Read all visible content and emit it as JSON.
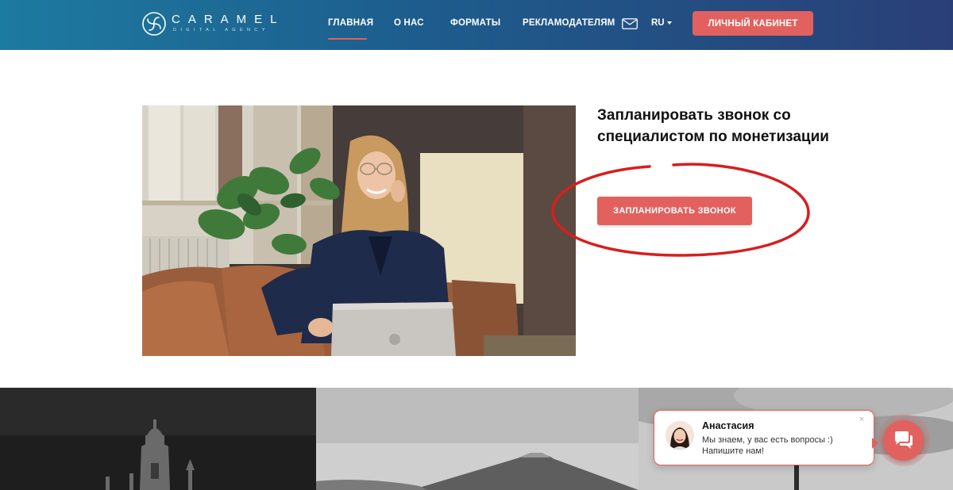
{
  "header": {
    "logo": {
      "name": "CARAMEL",
      "subtitle": "DIGITAL AGENCY",
      "icon": "spiral-logo-icon"
    },
    "nav": [
      {
        "label": "ГЛАВНАЯ",
        "active": true
      },
      {
        "label": "О НАС",
        "active": false
      },
      {
        "label": "ФОРМАТЫ",
        "active": false
      },
      {
        "label": "РЕКЛАМОДАТЕЛЯМ",
        "active": false
      }
    ],
    "mail_icon": "mail-icon",
    "language": "RU",
    "cabinet_button": "ЛИЧНЫЙ КАБИНЕТ"
  },
  "hero": {
    "title": "Запланировать звонок со специалистом по монетизации",
    "button": "ЗАПЛАНИРОВАТЬ ЗВОНОК"
  },
  "chat": {
    "name": "Анастасия",
    "message_line1": "Мы знаем, у вас есть вопросы :)",
    "message_line2": "Напишите нам!",
    "close": "×",
    "launcher_icon": "chat-bubble-icon"
  },
  "colors": {
    "accent": "#e2615e",
    "header_start": "#1d7aa0",
    "header_end": "#2a3f78",
    "annotation": "#d81e1e"
  }
}
